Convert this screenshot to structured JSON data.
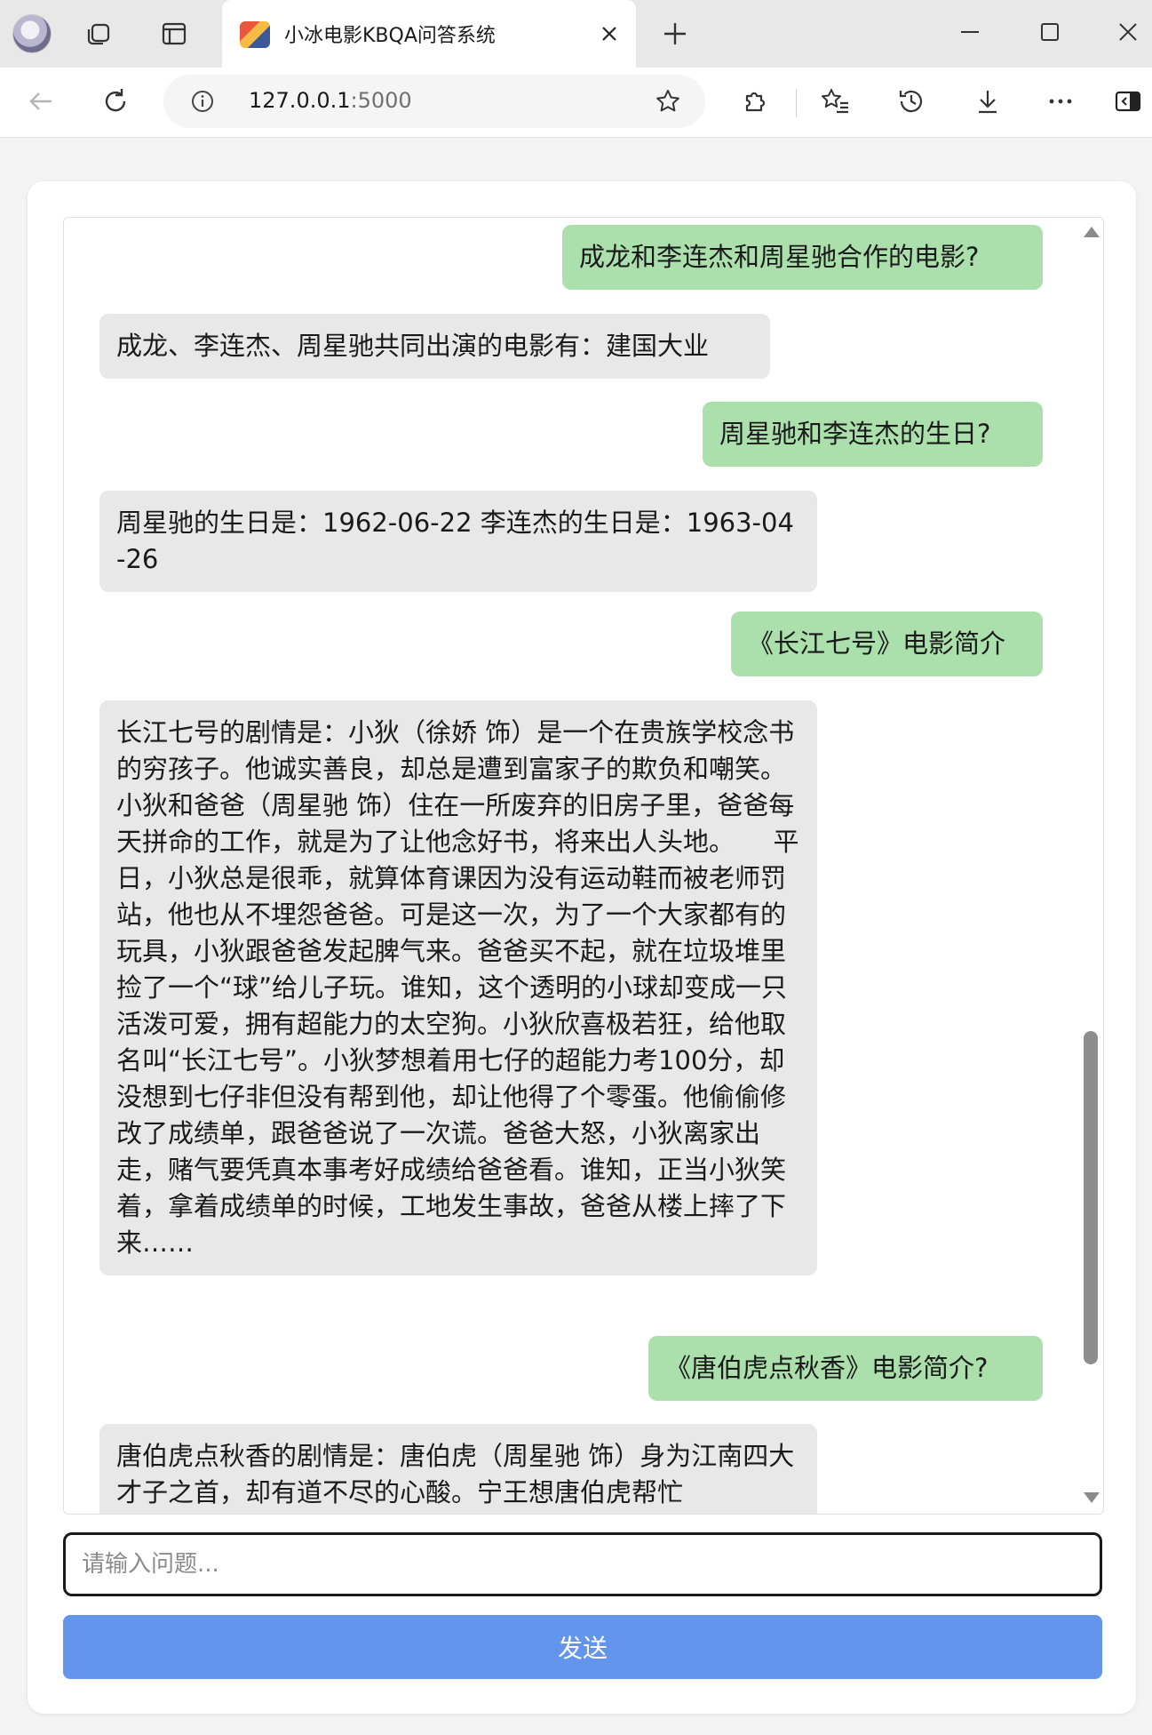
{
  "browser": {
    "tab_title": "小冰电影KBQA问答系统",
    "url_host": "127.0.0.1",
    "url_port": ":5000"
  },
  "chat": {
    "messages": [
      {
        "role": "user",
        "text": "成龙和李连杰和周星驰合作的电影?"
      },
      {
        "role": "bot",
        "text": "成龙、李连杰、周星驰共同出演的电影有：建国大业"
      },
      {
        "role": "user",
        "text": "周星驰和李连杰的生日?"
      },
      {
        "role": "bot",
        "text": "周星驰的生日是：1962-06-22 李连杰的生日是：1963-04-26"
      },
      {
        "role": "user",
        "text": "《长江七号》电影简介"
      },
      {
        "role": "bot",
        "text": "长江七号的剧情是：小狄（徐娇 饰）是一个在贵族学校念书的穷孩子。他诚实善良，却总是遭到富家子的欺负和嘲笑。小狄和爸爸（周星驰 饰）住在一所废弃的旧房子里，爸爸每天拼命的工作，就是为了让他念好书，将来出人头地。　　平日，小狄总是很乖，就算体育课因为没有运动鞋而被老师罚站，他也从不埋怨爸爸。可是这一次，为了一个大家都有的玩具，小狄跟爸爸发起脾气来。爸爸买不起，就在垃圾堆里捡了一个“球”给儿子玩。谁知，这个透明的小球却变成一只活泼可爱，拥有超能力的太空狗。小狄欣喜极若狂，给他取名叫“长江七号”。小狄梦想着用七仔的超能力考100分，却没想到七仔非但没有帮到他，却让他得了个零蛋。他偷偷修改了成绩单，跟爸爸说了一次谎。爸爸大怒，小狄离家出走，赌气要凭真本事考好成绩给爸爸看。谁知，正当小狄笑着，拿着成绩单的时候，工地发生事故，爸爸从楼上摔了下来……"
      },
      {
        "role": "user",
        "text": "《唐伯虎点秋香》电影简介?"
      },
      {
        "role": "bot",
        "text": "唐伯虎点秋香的剧情是：唐伯虎（周星驰 饰）身为江南四大才子之首，却有道不尽的心酸。宁王想唐伯虎帮忙"
      }
    ]
  },
  "input": {
    "placeholder": "请输入问题..."
  },
  "send_button": {
    "label": "发送"
  }
}
